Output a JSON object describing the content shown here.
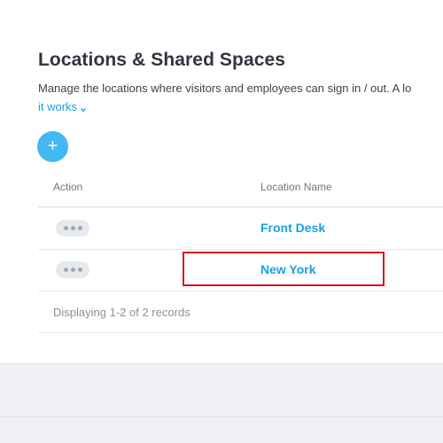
{
  "page": {
    "title": "Locations & Shared Spaces",
    "description": "Manage the locations where visitors and employees can sign in / out. A lo",
    "how_it_works_link": "it works",
    "add_button_label": "+"
  },
  "table": {
    "columns": [
      "Action",
      "Location Name"
    ],
    "rows": [
      {
        "location_name": "Front Desk"
      },
      {
        "location_name": "New York"
      }
    ],
    "footer": "Displaying 1-2 of 2 records"
  },
  "colors": {
    "accent": "#1a9ee3",
    "add_button": "#42b9f0",
    "highlight": "#d9151c"
  },
  "icons": {
    "add": "plus-icon",
    "link_chevron": "chevron-down-icon",
    "row_action": "more-dots-icon"
  }
}
